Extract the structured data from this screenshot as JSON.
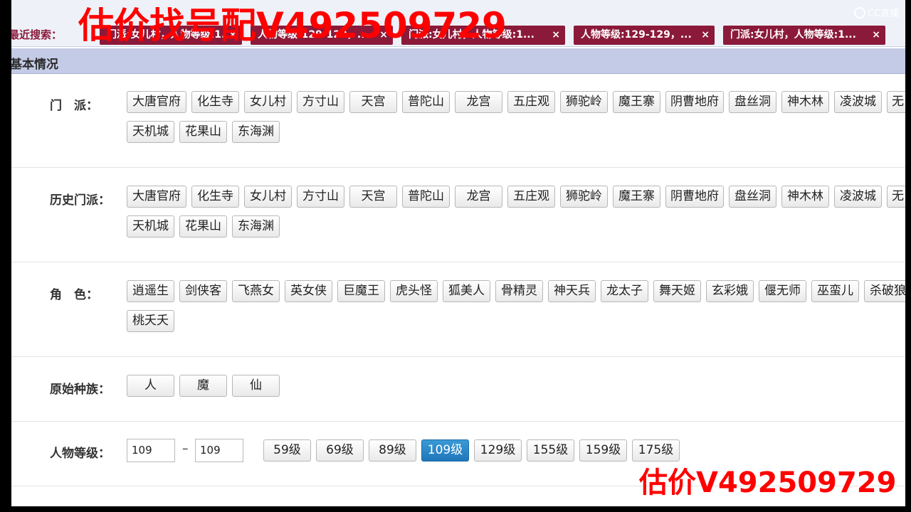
{
  "watermark": {
    "top": "估价找号配V492509729",
    "bottom": "估价V492509729"
  },
  "logo": {
    "text": "CC直播",
    "icon": "cc-logo-icon"
  },
  "recent": {
    "label": "最近搜索：",
    "chips": [
      {
        "label": "门派:女儿村，人物等级:1...",
        "close": "×"
      },
      {
        "label": "人物等级:129-129，...",
        "close": "×"
      },
      {
        "label": "门派:女儿村，人物等级:1...",
        "close": "×"
      },
      {
        "label": "人物等级:129-129，...",
        "close": "×"
      },
      {
        "label": "门派:女儿村，人物等级:1...",
        "close": "×"
      }
    ]
  },
  "section": {
    "title": "基本情况"
  },
  "sect_options": [
    "大唐官府",
    "化生寺",
    "女儿村",
    "方寸山",
    "天宫",
    "普陀山",
    "龙宫",
    "五庄观",
    "狮驼岭",
    "魔王寨",
    "阴曹地府",
    "盘丝洞",
    "神木林",
    "凌波城",
    "无",
    "天机城",
    "花果山",
    "东海渊"
  ],
  "filters": {
    "sect": {
      "label": "门　派："
    },
    "history_sect": {
      "label": "历史门派："
    },
    "role": {
      "label": "角　色：",
      "options": [
        "逍遥生",
        "剑侠客",
        "飞燕女",
        "英女侠",
        "巨魔王",
        "虎头怪",
        "狐美人",
        "骨精灵",
        "神天兵",
        "龙太子",
        "舞天姬",
        "玄彩娥",
        "偃无师",
        "巫蛮儿",
        "杀破狼",
        "桃夭夭"
      ]
    },
    "race": {
      "label": "原始种族：",
      "options": [
        "人",
        "魔",
        "仙"
      ]
    },
    "level": {
      "label": "人物等级：",
      "min": "109",
      "dash": "–",
      "max": "109",
      "presets": [
        "59级",
        "69级",
        "89级",
        "109级",
        "129级",
        "155级",
        "159级",
        "175级"
      ],
      "selected_preset": "109级"
    }
  }
}
